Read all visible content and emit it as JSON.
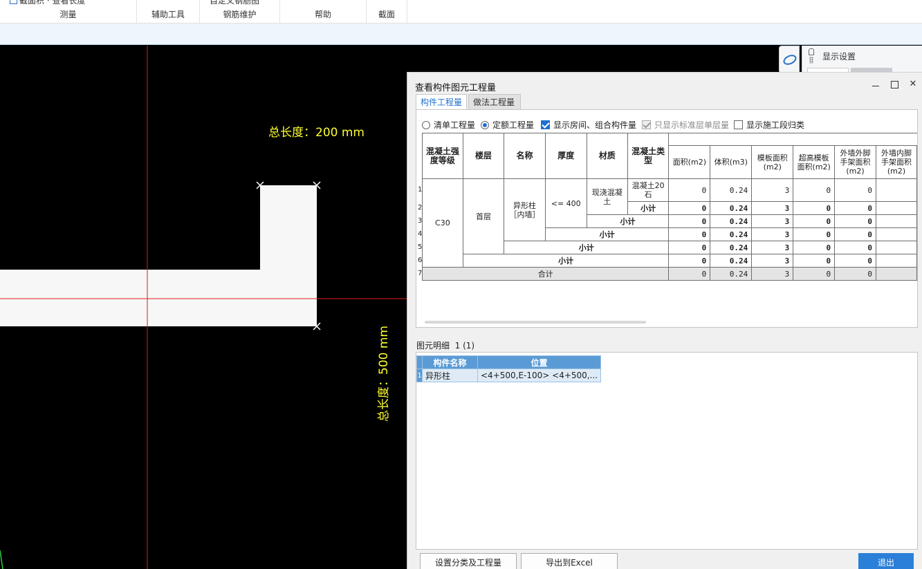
{
  "ribbon": {
    "groups": [
      {
        "label": "测量",
        "cut": "截面积 · 查看长度"
      },
      {
        "label": "辅助工具",
        "cut": ""
      },
      {
        "label": "钢筋维护",
        "cut": "自定义钢筋图"
      },
      {
        "label": "帮助",
        "cut": ""
      },
      {
        "label": "截面",
        "cut": ""
      }
    ]
  },
  "canvas": {
    "dim_horizontal": "总长度：200 mm",
    "dim_vertical": "总长度：500 mm"
  },
  "display_panel": {
    "title": "显示设置"
  },
  "dialog": {
    "title": "查看构件图元工程量",
    "tabs": [
      {
        "label": "构件工程量",
        "active": true
      },
      {
        "label": "做法工程量",
        "active": false
      }
    ],
    "options": {
      "radio_list": "清单工程量",
      "radio_quota": "定额工程量",
      "show_room": "显示房间、组合构件量",
      "only_std": "只显示标准层单层量",
      "show_stage": "显示施工段归类"
    },
    "table": {
      "headers": {
        "grade": "混凝土强度等级",
        "floor": "楼层",
        "name": "名称",
        "thickness": "厚度",
        "material": "材质",
        "type": "混凝土类型",
        "area": "面积(m2)",
        "volume": "体积(m3)",
        "formwork": "模板面积(m2)",
        "high_formwork": "超高模板面积(m2)",
        "ext_scaffold": "外墙外脚手架面积(m2)",
        "int_scaffold": "外墙内脚手架面积(m2)"
      },
      "row_numbers": [
        "1",
        "2",
        "3",
        "4",
        "5",
        "6",
        "7"
      ],
      "cells": {
        "grade": "C30",
        "floor": "首层",
        "name": "异形柱［内墙］",
        "thickness": "<= 400",
        "material": "现浇混凝土",
        "type": "混凝土20石",
        "subtotal": "小计",
        "total": "合计"
      },
      "rows": [
        {
          "area": "0",
          "volume": "0.24",
          "formwork": "3",
          "high": "0",
          "ext": "0"
        },
        {
          "area": "0",
          "volume": "0.24",
          "formwork": "3",
          "high": "0",
          "ext": "0"
        },
        {
          "area": "0",
          "volume": "0.24",
          "formwork": "3",
          "high": "0",
          "ext": "0"
        },
        {
          "area": "0",
          "volume": "0.24",
          "formwork": "3",
          "high": "0",
          "ext": "0"
        },
        {
          "area": "0",
          "volume": "0.24",
          "formwork": "3",
          "high": "0",
          "ext": "0"
        },
        {
          "area": "0",
          "volume": "0.24",
          "formwork": "3",
          "high": "0",
          "ext": "0"
        },
        {
          "area": "0",
          "volume": "0.24",
          "formwork": "3",
          "high": "0",
          "ext": "0"
        }
      ]
    },
    "details": {
      "title": "图元明细",
      "count": "1 (1)",
      "headers": {
        "name": "构件名称",
        "position": "位置"
      },
      "rows": [
        {
          "num": "1",
          "name": "异形柱",
          "position": "<4+500,E-100> <4+500,..."
        }
      ]
    },
    "buttons": {
      "setup": "设置分类及工程量",
      "export": "导出到Excel",
      "exit": "退出"
    }
  }
}
